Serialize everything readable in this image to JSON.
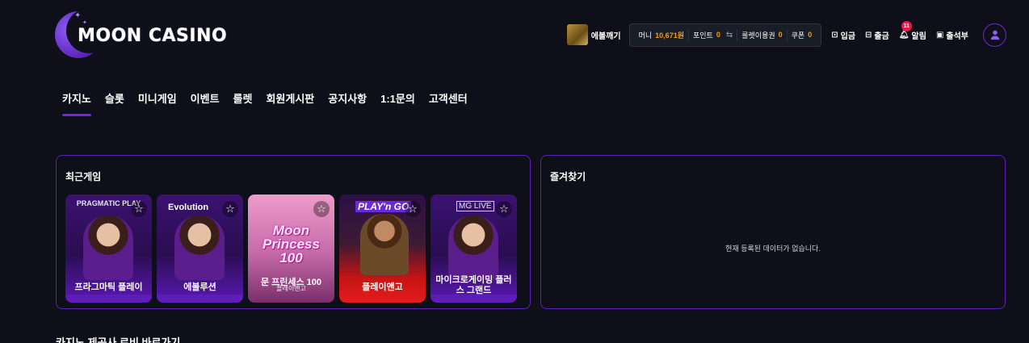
{
  "header": {
    "logo_text": "MOON CASINO",
    "crack_label": "에볼깨기",
    "stats": [
      {
        "label": "머니",
        "value": "10,671원"
      },
      {
        "label": "포인트",
        "value": "0"
      },
      {
        "label": "룰렛이용권",
        "value": "0"
      },
      {
        "label": "쿠폰",
        "value": "0"
      }
    ],
    "links": {
      "deposit": "입금",
      "withdraw": "출금",
      "alarm": "알림",
      "alarm_count": "11",
      "attendance": "출석부"
    }
  },
  "nav": [
    "카지노",
    "슬롯",
    "미니게임",
    "이벤트",
    "룰렛",
    "회원게시판",
    "공지사항",
    "1:1문의",
    "고객센터"
  ],
  "recent": {
    "title": "최근게임",
    "games": [
      {
        "brand": "PRAGMATIC PLAY",
        "name": "프라그마틱 플레이"
      },
      {
        "brand": "Evolution",
        "name": "에볼루션"
      },
      {
        "brand": "Moon Princess 100",
        "name": "문 프린세스 100",
        "sub": "플레이앤고"
      },
      {
        "brand": "PLAY'n GO",
        "name": "플레이앤고"
      },
      {
        "brand": "MG LIVE",
        "name": "마이크로게이밍 플러스 그랜드"
      }
    ]
  },
  "favorites": {
    "title": "즐겨찾기",
    "empty": "현재 등록된 데이터가 없습니다."
  },
  "next_section": "카지노 제공사 로비 바로가기",
  "colors": {
    "background": "#0f0f1a",
    "accent": "#6d28d9",
    "amount": "#f59e0b"
  }
}
